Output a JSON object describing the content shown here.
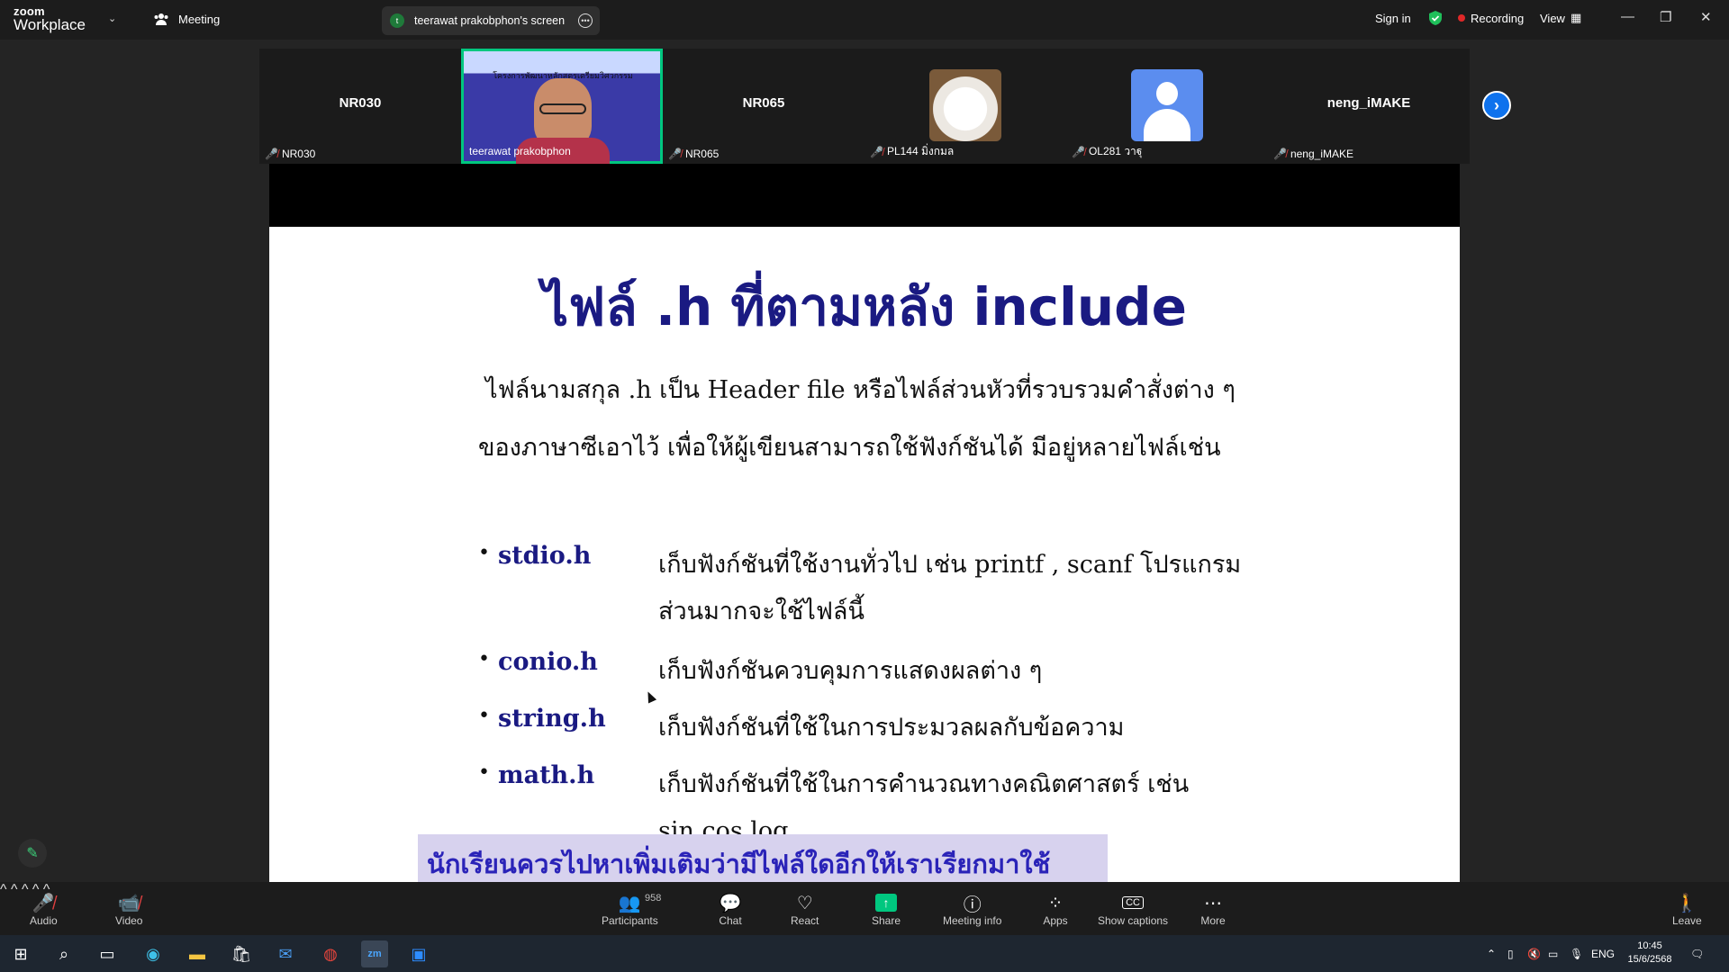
{
  "titlebar": {
    "logo_line1": "zoom",
    "logo_line2": "Workplace",
    "meeting_label": "Meeting",
    "screen_tab_initial": "t",
    "screen_tab_label": "teerawat prakobphon's screen",
    "sign_in": "Sign in",
    "recording": "Recording",
    "view": "View"
  },
  "participants": [
    {
      "display": "NR030",
      "label": "NR030",
      "type": "name"
    },
    {
      "display": "",
      "label": "teerawat prakobphon",
      "type": "camera",
      "slide_caption": "โครงการพัฒนาหลักสูตรเตรียมวิศวกรรม"
    },
    {
      "display": "NR065",
      "label": "NR065",
      "type": "name"
    },
    {
      "display": "",
      "label": "PL144 มิ่งกมล",
      "type": "dog"
    },
    {
      "display": "",
      "label": "OL281 วาฐุ",
      "type": "person"
    },
    {
      "display": "neng_iMAKE",
      "label": "neng_iMAKE",
      "type": "name"
    }
  ],
  "slide": {
    "title": "ไฟล์ .h ที่ตามหลัง include",
    "intro_line1": "ไฟล์นามสกุล .h เป็น Header file หรือไฟล์ส่วนหัวที่รวบรวมคำสั่งต่าง ๆ",
    "intro_line2": "ของภาษาซีเอาไว้ เพื่อให้ผู้เขียนสามารถใช้ฟังก์ชันได้ มีอยู่หลายไฟล์เช่น",
    "bullets": [
      {
        "lib": "stdio.h",
        "desc": "เก็บฟังก์ชันที่ใช้งานทั่วไป เช่น printf , scanf โปรแกรมส่วนมากจะใช้ไฟล์นี้"
      },
      {
        "lib": "conio.h",
        "desc": "เก็บฟังก์ชันควบคุมการแสดงผลต่าง ๆ"
      },
      {
        "lib": "string.h",
        "desc": "เก็บฟังก์ชันที่ใช้ในการประมวลผลกับข้อความ"
      },
      {
        "lib": "math.h",
        "desc": "เก็บฟังก์ชันที่ใช้ในการคำนวณทางคณิตศาสตร์ เช่น sin,cos,log"
      }
    ],
    "note": "นักเรียนควรไปหาเพิ่มเติมว่ามีไฟล์ใดอีกให้เราเรียกมาใช้งาน......"
  },
  "toolbar": {
    "audio": "Audio",
    "video": "Video",
    "participants": "Participants",
    "participant_count": "958",
    "chat": "Chat",
    "react": "React",
    "share": "Share",
    "meeting_info": "Meeting info",
    "apps": "Apps",
    "show_captions": "Show captions",
    "more": "More",
    "leave": "Leave"
  },
  "taskbar": {
    "language": "ENG",
    "time": "10:45",
    "date": "15/6/2568"
  },
  "colors": {
    "accent_green": "#00c77f",
    "zoom_blue": "#0e72ed",
    "slide_title": "#1a1a82",
    "recording_red": "#e02828"
  }
}
